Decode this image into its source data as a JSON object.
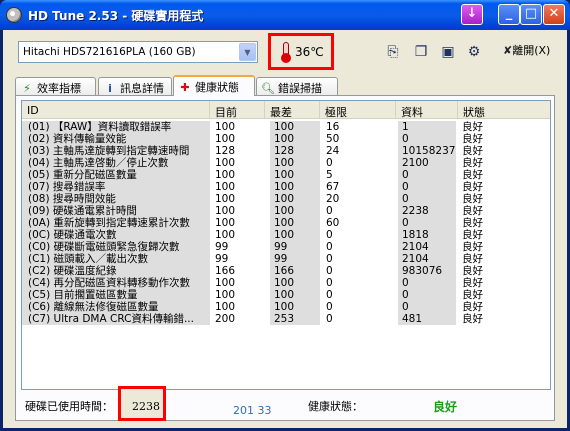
{
  "window": {
    "title": "HD Tune 2.53 - 硬碟實用程式"
  },
  "toolbar": {
    "drive": "Hitachi HDS721616PLA (160 GB)",
    "temperature": "36℃",
    "exit_label": "離開(X)"
  },
  "tabs": [
    {
      "label": "效率指標",
      "icon": "benchmark-icon"
    },
    {
      "label": "訊息詳情",
      "icon": "info-icon"
    },
    {
      "label": "健康狀態",
      "icon": "health-cross-icon"
    },
    {
      "label": "錯誤掃描",
      "icon": "magnifier-icon"
    }
  ],
  "table": {
    "headers": [
      "ID",
      "目前",
      "最差",
      "極限",
      "資料",
      "狀態"
    ],
    "rows": [
      {
        "id": "(01) 【RAW】資料讀取錯誤率",
        "current": "100",
        "worst": "100",
        "threshold": "16",
        "data": "1",
        "status": "良好"
      },
      {
        "id": "(02) 資料傳輸量效能",
        "current": "100",
        "worst": "100",
        "threshold": "50",
        "data": "0",
        "status": "良好"
      },
      {
        "id": "(03) 主軸馬達旋轉到指定轉速時間",
        "current": "128",
        "worst": "128",
        "threshold": "24",
        "data": "10158237",
        "status": "良好"
      },
      {
        "id": "(04) 主軸馬達啓動／停止次數",
        "current": "100",
        "worst": "100",
        "threshold": "0",
        "data": "2100",
        "status": "良好"
      },
      {
        "id": "(05) 重新分配磁區數量",
        "current": "100",
        "worst": "100",
        "threshold": "5",
        "data": "0",
        "status": "良好"
      },
      {
        "id": "(07) 搜尋錯誤率",
        "current": "100",
        "worst": "100",
        "threshold": "67",
        "data": "0",
        "status": "良好"
      },
      {
        "id": "(08) 搜尋時間效能",
        "current": "100",
        "worst": "100",
        "threshold": "20",
        "data": "0",
        "status": "良好"
      },
      {
        "id": "(09) 硬碟通電累計時間",
        "current": "100",
        "worst": "100",
        "threshold": "0",
        "data": "2238",
        "status": "良好"
      },
      {
        "id": "(0A) 重新旋轉到指定轉速累計次數",
        "current": "100",
        "worst": "100",
        "threshold": "60",
        "data": "0",
        "status": "良好"
      },
      {
        "id": "(0C) 硬碟通電次數",
        "current": "100",
        "worst": "100",
        "threshold": "0",
        "data": "1818",
        "status": "良好"
      },
      {
        "id": "(C0) 硬碟斷電磁頭緊急復歸次數",
        "current": "99",
        "worst": "99",
        "threshold": "0",
        "data": "2104",
        "status": "良好"
      },
      {
        "id": "(C1) 磁頭載入／載出次數",
        "current": "99",
        "worst": "99",
        "threshold": "0",
        "data": "2104",
        "status": "良好"
      },
      {
        "id": "(C2) 硬碟溫度紀錄",
        "current": "166",
        "worst": "166",
        "threshold": "0",
        "data": "983076",
        "status": "良好"
      },
      {
        "id": "(C4) 再分配磁區資料轉移動作次數",
        "current": "100",
        "worst": "100",
        "threshold": "0",
        "data": "0",
        "status": "良好"
      },
      {
        "id": "(C5) 目前擱置磁區數量",
        "current": "100",
        "worst": "100",
        "threshold": "0",
        "data": "0",
        "status": "良好"
      },
      {
        "id": "(C6) 離線無法修復磁區數量",
        "current": "100",
        "worst": "100",
        "threshold": "0",
        "data": "0",
        "status": "良好"
      },
      {
        "id": "(C7) Ultra DMA CRC資料傳輸錯...",
        "current": "200",
        "worst": "253",
        "threshold": "0",
        "data": "481",
        "status": "良好"
      }
    ]
  },
  "footer": {
    "counter": "201 33",
    "hours_label": "硬碟已使用時間：",
    "hours_value": "2238",
    "health_label": "健康狀態：",
    "health_value": "良好"
  },
  "colors": {
    "highlight_border": "#ff0000",
    "health_good": "#16a016",
    "title_bar": "#0058ee"
  }
}
